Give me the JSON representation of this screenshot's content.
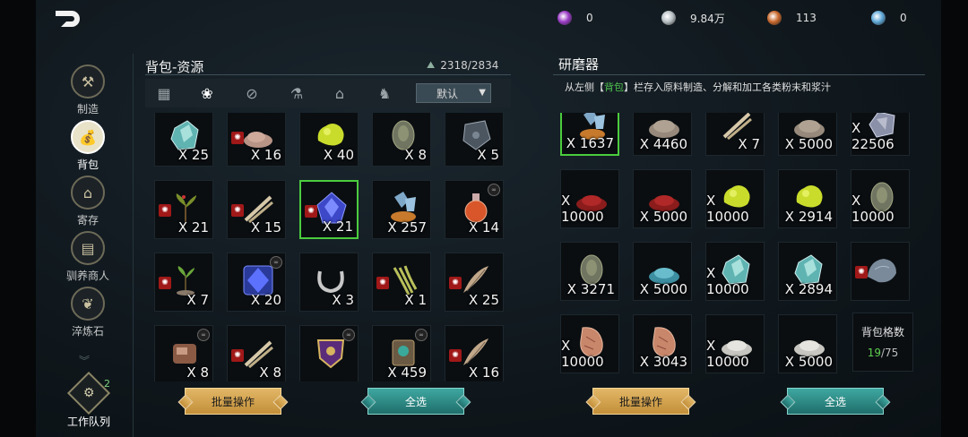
{
  "currencies": [
    {
      "icon": "purple-orb-icon",
      "value": "0",
      "color": "#9b3cc6"
    },
    {
      "icon": "silver-coin-icon",
      "value": "9.84万",
      "color": "#b8c0c4"
    },
    {
      "icon": "copper-coin-icon",
      "value": "113",
      "color": "#c8682c"
    },
    {
      "icon": "blue-gem-icon",
      "value": "0",
      "color": "#5fa8d8"
    }
  ],
  "sidenav": [
    {
      "id": "craft",
      "label": "制造",
      "icon": "hammer-icon"
    },
    {
      "id": "backpack",
      "label": "背包",
      "icon": "bag-icon",
      "active": true
    },
    {
      "id": "storage",
      "label": "寄存",
      "icon": "house-icon"
    },
    {
      "id": "tamer",
      "label": "驯养商人",
      "icon": "shop-icon"
    },
    {
      "id": "quench",
      "label": "淬炼石",
      "icon": "leaf-stone-icon"
    }
  ],
  "queue": {
    "label": "工作队列",
    "badge": "2"
  },
  "left_panel": {
    "title": "背包-资源",
    "capacity": "2318/2834",
    "sort_label": "默认",
    "batch_label": "批量操作",
    "select_all_label": "全选",
    "items": [
      {
        "qty": "X 25",
        "kind": "crystal"
      },
      {
        "qty": "X 16",
        "kind": "powder",
        "lock": true
      },
      {
        "qty": "X 40",
        "kind": "sulfur"
      },
      {
        "qty": "X 8",
        "kind": "ore"
      },
      {
        "qty": "X 5",
        "kind": "armor"
      },
      {
        "qty": "X 21",
        "kind": "herb",
        "lock": true
      },
      {
        "qty": "X 15",
        "kind": "bone",
        "lock": true
      },
      {
        "qty": "X 21",
        "kind": "bluegem",
        "lock": true,
        "selected": true
      },
      {
        "qty": "X 257",
        "kind": "orecrystal"
      },
      {
        "qty": "X 14",
        "kind": "potion",
        "link": true
      },
      {
        "qty": "X 7",
        "kind": "sprout",
        "lock": true
      },
      {
        "qty": "X 20",
        "kind": "bluecrystal",
        "link": true
      },
      {
        "qty": "X 3",
        "kind": "horn"
      },
      {
        "qty": "X 1",
        "kind": "grass",
        "lock": true
      },
      {
        "qty": "X 25",
        "kind": "feather",
        "lock": true
      },
      {
        "qty": "X 8",
        "kind": "meat",
        "link": true
      },
      {
        "qty": "X 8",
        "kind": "bone",
        "lock": true
      },
      {
        "qty": "",
        "kind": "shield",
        "link": true
      },
      {
        "qty": "X 459",
        "kind": "device",
        "link": true
      },
      {
        "qty": "X 16",
        "kind": "feather",
        "lock": true
      }
    ]
  },
  "right_panel": {
    "title": "研磨器",
    "description_prefix": "从左侧【",
    "description_highlight": "背包",
    "description_suffix": "】栏存入原料制造、分解和加工各类粉末和浆汁",
    "batch_label": "批量操作",
    "select_all_label": "全选",
    "bag_slots_label": "背包格数",
    "bag_slots_used": "19",
    "bag_slots_total": "/75",
    "items": [
      {
        "qty": "X 1637",
        "kind": "orecrystal",
        "selected": true
      },
      {
        "qty": "X 4460",
        "kind": "dirt"
      },
      {
        "qty": "X 7",
        "kind": "bone"
      },
      {
        "qty": "X 5000",
        "kind": "dirt"
      },
      {
        "qty": "X 22506",
        "kind": "metal"
      },
      {
        "qty": "X 10000",
        "kind": "redpowder"
      },
      {
        "qty": "X 5000",
        "kind": "redpowder"
      },
      {
        "qty": "X 10000",
        "kind": "sulfur"
      },
      {
        "qty": "X 2914",
        "kind": "sulfur"
      },
      {
        "qty": "X 10000",
        "kind": "ore"
      },
      {
        "qty": "X 3271",
        "kind": "ore"
      },
      {
        "qty": "X 5000",
        "kind": "bluepowder"
      },
      {
        "qty": "X 10000",
        "kind": "crystal"
      },
      {
        "qty": "X 2894",
        "kind": "crystal"
      },
      {
        "qty": "",
        "kind": "rock",
        "lock": true
      },
      {
        "qty": "X 10000",
        "kind": "copperore"
      },
      {
        "qty": "X 3043",
        "kind": "copperore"
      },
      {
        "qty": "X 10000",
        "kind": "whitepowder"
      },
      {
        "qty": "X 5000",
        "kind": "whitepowder"
      }
    ]
  }
}
